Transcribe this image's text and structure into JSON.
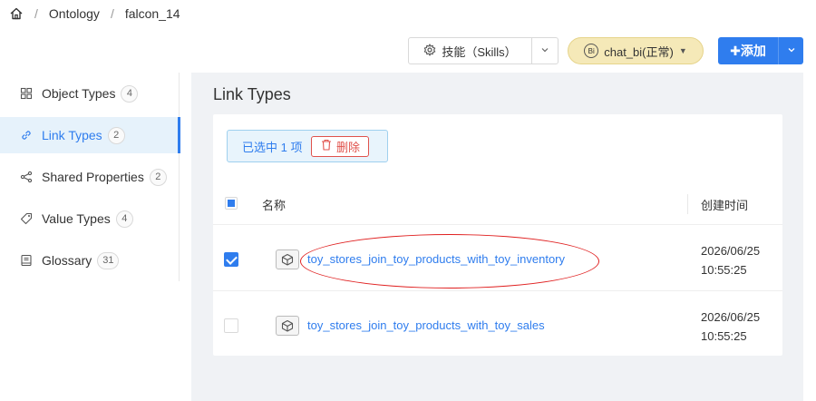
{
  "breadcrumb": {
    "items": [
      "Ontology",
      "falcon_14"
    ],
    "separator": "/"
  },
  "toolbar": {
    "skills_label": "技能（Skills）",
    "bi_label": "chat_bi(正常)",
    "bi_badge": "Bi",
    "add_label": "✚添加"
  },
  "sidebar": {
    "items": [
      {
        "label": "Object Types",
        "count": "4"
      },
      {
        "label": "Link Types",
        "count": "2"
      },
      {
        "label": "Shared Properties",
        "count": "2"
      },
      {
        "label": "Value Types",
        "count": "4"
      },
      {
        "label": "Glossary",
        "count": "31"
      }
    ],
    "active_index": 1
  },
  "main": {
    "title": "Link Types",
    "selection": {
      "text": "已选中 1 项",
      "delete_label": "删除"
    },
    "table": {
      "columns": [
        "名称",
        "创建时间"
      ],
      "rows": [
        {
          "name": "toy_stores_join_toy_products_with_toy_inventory",
          "date": "2026/06/25",
          "time": "10:55:25",
          "checked": true
        },
        {
          "name": "toy_stores_join_toy_products_with_toy_sales",
          "date": "2026/06/25",
          "time": "10:55:25",
          "checked": false
        }
      ]
    }
  },
  "colors": {
    "accent": "#2f7dee",
    "danger": "#e0524c",
    "bi_pill": "#f5e9b8",
    "highlight": "#e02020"
  }
}
